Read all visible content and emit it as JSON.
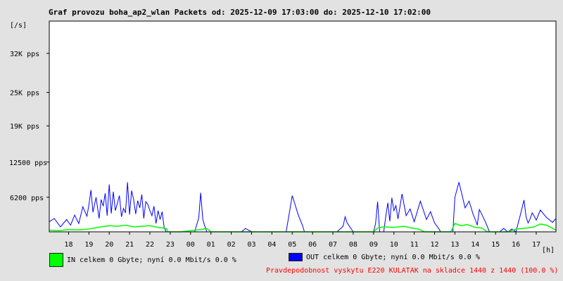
{
  "header": {
    "title": "Graf provozu boha_ap2_wlan Packets od: 2025-12-09 17:03:00 do: 2025-12-10 17:02:00",
    "y_unit": "[/s]",
    "x_unit": "[h]"
  },
  "legend": {
    "in_text": "IN celkem 0 Gbyte; nyní   0.0 Mbit/s 0.0 %",
    "out_text": "OUT celkem 0 Gbyte; nyní   0.0 Mbit/s 0.0 %",
    "in_color": "#00ff00",
    "out_color": "#0000ff"
  },
  "footer": {
    "probability": "Pravdepodobnost vyskytu E220 KULATAK na skladce 1440 z 1440 (100.0 %)"
  },
  "chart_data": {
    "type": "line",
    "title": "Graf provozu boha_ap2_wlan Packets od: 2025-12-09 17:03:00 do: 2025-12-10 17:02:00",
    "ylabel": "[/s]",
    "xlabel": "[h]",
    "x_tick_labels": [
      "18",
      "19",
      "20",
      "21",
      "22",
      "23",
      "00",
      "01",
      "02",
      "03",
      "04",
      "05",
      "06",
      "07",
      "08",
      "09",
      "10",
      "11",
      "12",
      "13",
      "14",
      "15",
      "16",
      "17"
    ],
    "y_tick_labels": [
      "6200 pps",
      "12500 pps",
      "19K pps",
      "25K pps",
      "32K pps"
    ],
    "y_tick_values": [
      6200,
      12500,
      19000,
      25000,
      32000
    ],
    "ylim": [
      0,
      37800
    ],
    "grid": false,
    "legend_position": "bottom",
    "series": [
      {
        "name": "OUT",
        "color": "#0000ff",
        "hours": [
          17.05,
          17.3,
          17.6,
          17.9,
          18.1,
          18.3,
          18.5,
          18.7,
          18.9,
          19.0,
          19.1,
          19.2,
          19.35,
          19.5,
          19.6,
          19.7,
          19.8,
          19.9,
          20.0,
          20.1,
          20.2,
          20.3,
          20.4,
          20.5,
          20.6,
          20.7,
          20.8,
          20.9,
          21.0,
          21.1,
          21.2,
          21.3,
          21.4,
          21.5,
          21.6,
          21.7,
          21.8,
          21.9,
          22.0,
          22.1,
          22.2,
          22.3,
          22.4,
          22.5,
          22.6,
          22.7,
          22.8,
          22.9,
          23.0,
          23.1,
          23.2,
          23.3,
          23.5,
          23.8,
          24.2,
          24.4,
          24.5,
          24.6,
          24.7,
          24.8,
          25.0,
          25.3,
          25.5,
          25.8,
          26.2,
          26.5,
          26.7,
          27.0,
          27.4,
          27.5,
          27.6,
          27.8,
          28.2,
          28.5,
          28.7,
          29.0,
          29.3,
          29.5,
          29.6,
          29.7,
          29.9,
          30.1,
          30.4,
          30.6,
          30.8,
          31.0,
          31.2,
          31.5,
          31.6,
          31.7,
          32.0,
          32.3,
          32.5,
          32.6,
          32.8,
          32.9,
          33.0,
          33.1,
          33.2,
          33.3,
          33.4,
          33.5,
          33.6,
          33.7,
          33.8,
          33.9,
          34.0,
          34.1,
          34.2,
          34.4,
          34.6,
          34.8,
          35.0,
          35.3,
          35.6,
          35.8,
          36.0,
          36.2,
          36.3,
          36.4,
          36.5,
          36.6,
          36.7,
          36.8,
          36.9,
          37.0,
          37.2,
          37.5,
          37.7,
          37.9,
          38.0,
          38.1,
          38.2,
          38.3,
          38.5,
          38.7,
          38.9,
          39.0,
          39.2,
          39.4,
          39.6,
          39.8,
          40.0,
          40.2,
          40.4,
          40.5,
          40.6,
          40.7,
          40.8,
          40.9,
          41.0,
          41.2,
          41.5,
          41.8,
          41.97
        ],
        "values": [
          1800,
          2400,
          900,
          2200,
          1200,
          3000,
          1500,
          4500,
          2800,
          4800,
          7500,
          3500,
          6200,
          2400,
          5800,
          4600,
          6900,
          2900,
          8500,
          3300,
          7200,
          3800,
          5100,
          6500,
          2700,
          4200,
          3400,
          8900,
          3100,
          7400,
          5800,
          3200,
          5600,
          4300,
          6700,
          2400,
          5400,
          4900,
          3800,
          2900,
          4600,
          1500,
          3800,
          2200,
          3600,
          800,
          0,
          0,
          0,
          0,
          0,
          0,
          0,
          0,
          0,
          2500,
          7000,
          2300,
          1000,
          0,
          0,
          0,
          0,
          0,
          0,
          0,
          600,
          0,
          0,
          0,
          0,
          0,
          0,
          0,
          0,
          6500,
          3000,
          1200,
          0,
          0,
          0,
          0,
          0,
          0,
          0,
          0,
          0,
          1000,
          2700,
          1600,
          0,
          0,
          0,
          0,
          0,
          0,
          0,
          1500,
          5400,
          0,
          0,
          0,
          2800,
          5200,
          1900,
          6100,
          3800,
          4700,
          2300,
          6800,
          2900,
          4100,
          1800,
          5500,
          2200,
          3600,
          1600,
          600,
          0,
          0,
          0,
          0,
          0,
          0,
          0,
          6200,
          8900,
          4300,
          5500,
          3100,
          2200,
          1200,
          4000,
          3300,
          1800,
          0,
          0,
          0,
          0,
          600,
          0,
          500,
          0,
          2800,
          5700,
          2700,
          1600,
          2300,
          3400,
          2800,
          2100,
          3900,
          2600,
          1700,
          2400,
          3000,
          4200,
          2100,
          5100,
          8300,
          1700,
          3800,
          3100,
          1200,
          2500,
          1500,
          2400,
          1800,
          2900,
          3200,
          1500,
          2600,
          1400,
          1300
        ]
      },
      {
        "name": "IN",
        "color": "#00ff00",
        "hours": [
          17.05,
          17.5,
          18.0,
          18.5,
          19.0,
          19.3,
          19.6,
          20.0,
          20.4,
          20.8,
          21.2,
          21.6,
          22.0,
          22.4,
          22.8,
          22.9,
          23.5,
          24.5,
          24.8,
          25.0,
          33.0,
          33.2,
          33.5,
          34.0,
          34.5,
          35.0,
          35.2,
          35.5,
          36.8,
          37.0,
          37.3,
          37.6,
          38.0,
          38.3,
          38.6,
          39.0,
          39.3,
          39.6,
          40.0,
          40.3,
          40.6,
          40.9,
          41.2,
          41.5,
          41.97
        ],
        "values": [
          300,
          200,
          400,
          350,
          500,
          700,
          900,
          1100,
          1000,
          1200,
          900,
          1000,
          1100,
          800,
          600,
          0,
          0,
          400,
          600,
          0,
          0,
          700,
          900,
          800,
          1000,
          600,
          500,
          0,
          0,
          1500,
          1100,
          1300,
          800,
          700,
          0,
          0,
          0,
          0,
          500,
          600,
          700,
          900,
          1400,
          1200,
          300
        ]
      }
    ]
  }
}
